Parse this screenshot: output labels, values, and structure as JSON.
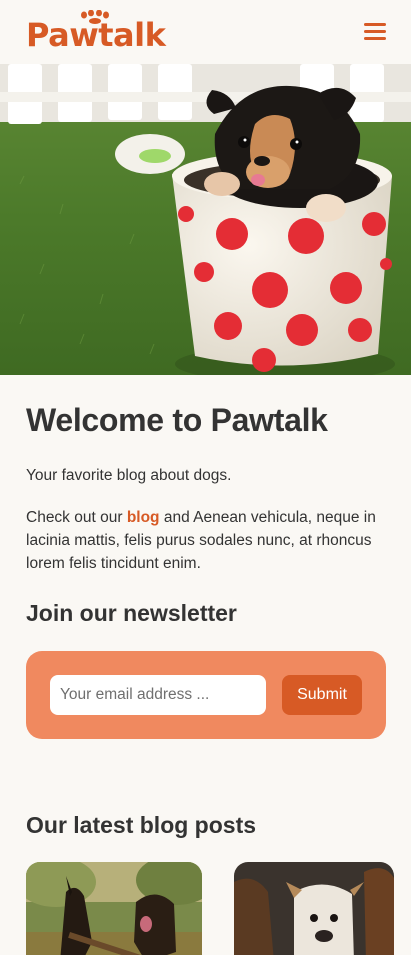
{
  "header": {
    "logo_text": "Pawtalk",
    "menu_icon": "hamburger-menu-icon",
    "brand_color": "#d75a25"
  },
  "hero": {
    "image": "puppy-in-polka-dot-cup-photo"
  },
  "main": {
    "title": "Welcome to Pawtalk",
    "tagline": "Your favorite blog about dogs.",
    "intro_prefix": "Check out our",
    "intro_link": "blog",
    "intro_suffix": "and Aenean vehicula, neque in lacinia mattis, felis purus sodales nunc, at rhoncus lorem felis tincidunt enim."
  },
  "newsletter": {
    "title": "Join our newsletter",
    "email_placeholder": "Your email address ...",
    "email_value": "",
    "submit_label": "Submit",
    "box_color": "#f0895f"
  },
  "blog": {
    "title": "Our latest blog posts",
    "posts": [
      {
        "image": "dogs-playing-with-stick-photo"
      },
      {
        "image": "three-dogs-portrait-photo"
      }
    ]
  }
}
